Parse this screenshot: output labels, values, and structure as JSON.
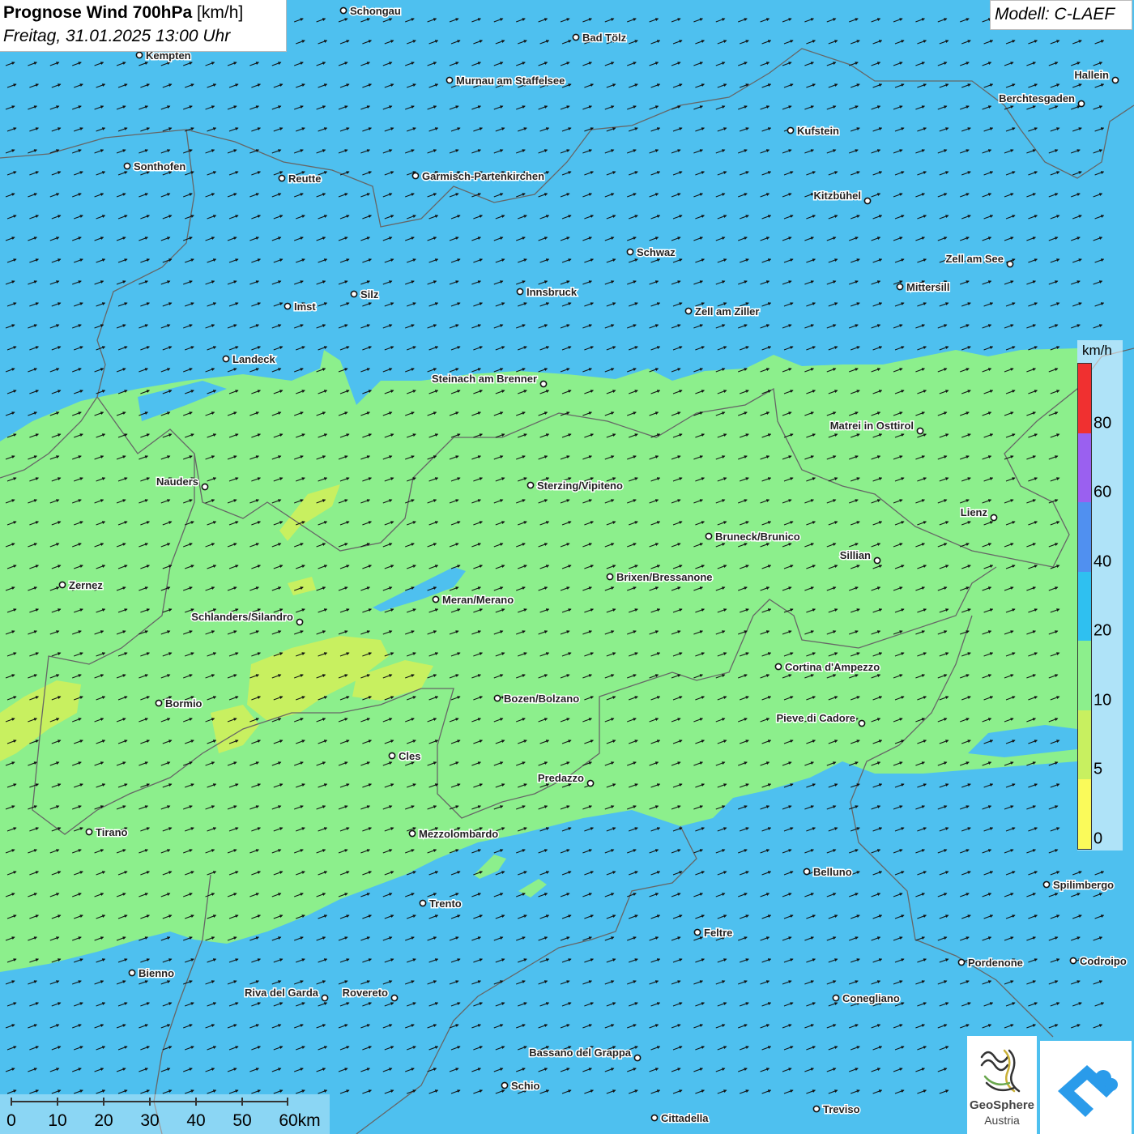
{
  "title": {
    "product": "Prognose Wind 700hPa",
    "unit": "[km/h]",
    "datetime": "Freitag, 31.01.2025 13:00 Uhr"
  },
  "model": "Modell: C-LAEF",
  "legend": {
    "unit": "km/h",
    "classes": [
      {
        "from": 0,
        "to": 5,
        "color": "#fafa5a"
      },
      {
        "from": 5,
        "to": 10,
        "color": "#c8f060"
      },
      {
        "from": 10,
        "to": 20,
        "color": "#8cef8c"
      },
      {
        "from": 20,
        "to": 40,
        "color": "#2fc0f0"
      },
      {
        "from": 40,
        "to": 60,
        "color": "#5090f0"
      },
      {
        "from": 60,
        "to": 80,
        "color": "#9a60f0"
      },
      {
        "from": 80,
        "to": 100,
        "color": "#f03030"
      }
    ],
    "ticks": [
      "0",
      "5",
      "10",
      "20",
      "40",
      "60",
      "80"
    ]
  },
  "scale_bar": {
    "labels": [
      "0",
      "10",
      "20",
      "30",
      "40",
      "50",
      "60km"
    ]
  },
  "wind": {
    "direction": "from south-west",
    "field_colors": {
      "calm": "#c8f060",
      "moderate": "#8cef8c",
      "strong": "#4ec0ef"
    }
  },
  "cities": [
    {
      "name": "Schongau"
    },
    {
      "name": "Bad Tölz"
    },
    {
      "name": "Kempten"
    },
    {
      "name": "Murnau am Staffelsee"
    },
    {
      "name": "Hallein"
    },
    {
      "name": "Berchtesgaden"
    },
    {
      "name": "Kufstein"
    },
    {
      "name": "Sonthofen"
    },
    {
      "name": "Reutte"
    },
    {
      "name": "Garmisch-Partenkirchen"
    },
    {
      "name": "Kitzbühel"
    },
    {
      "name": "Schwaz"
    },
    {
      "name": "Zell am See"
    },
    {
      "name": "Mittersill"
    },
    {
      "name": "Innsbruck"
    },
    {
      "name": "Silz"
    },
    {
      "name": "Imst"
    },
    {
      "name": "Zell am Ziller"
    },
    {
      "name": "Landeck"
    },
    {
      "name": "Steinach am Brenner"
    },
    {
      "name": "Matrei in Osttirol"
    },
    {
      "name": "Nauders"
    },
    {
      "name": "Sterzing/Vipiteno"
    },
    {
      "name": "Lienz"
    },
    {
      "name": "Bruneck/Brunico"
    },
    {
      "name": "Sillian"
    },
    {
      "name": "Zernez"
    },
    {
      "name": "Brixen/Bressanone"
    },
    {
      "name": "Meran/Merano"
    },
    {
      "name": "Schlanders/Silandro"
    },
    {
      "name": "Cortina d'Ampezzo"
    },
    {
      "name": "Bozen/Bolzano"
    },
    {
      "name": "Bormio"
    },
    {
      "name": "Pieve di Cadore"
    },
    {
      "name": "Cles"
    },
    {
      "name": "Predazzo"
    },
    {
      "name": "Tirano"
    },
    {
      "name": "Mezzolombardo"
    },
    {
      "name": "Belluno"
    },
    {
      "name": "Spilimbergo"
    },
    {
      "name": "Trento"
    },
    {
      "name": "Feltre"
    },
    {
      "name": "Pordenone"
    },
    {
      "name": "Codroipo"
    },
    {
      "name": "Bienno"
    },
    {
      "name": "Riva del Garda"
    },
    {
      "name": "Rovereto"
    },
    {
      "name": "Conegliano"
    },
    {
      "name": "Bassano del Grappa"
    },
    {
      "name": "Schio"
    },
    {
      "name": "Treviso"
    },
    {
      "name": "Cittadella"
    }
  ],
  "logos": {
    "geosphere_line1": "GeoSphere",
    "geosphere_line2": "Austria"
  }
}
